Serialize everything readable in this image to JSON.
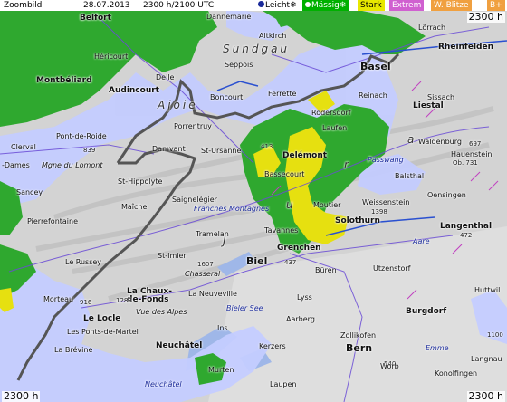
{
  "header": {
    "title": "Zoombild",
    "date": "28.07.2013",
    "info": "2300 h/2100 UTC",
    "legend": [
      {
        "key": "leicht",
        "label": "Leicht",
        "color": "#c8d0ff",
        "symbol": "❄"
      },
      {
        "key": "maessig",
        "label": "Mässig",
        "color": "#00b000",
        "symbol": "❄"
      },
      {
        "key": "stark",
        "label": "Stark",
        "color": "#e8e800",
        "symbol": ""
      },
      {
        "key": "extrem",
        "label": "Extrem",
        "color": "#d060d0",
        "symbol": ""
      },
      {
        "key": "blitze",
        "label": "W. Blitze",
        "color": "#f0a040",
        "symbol": ""
      },
      {
        "key": "bt",
        "label": "B+",
        "color": "#f0a040",
        "symbol": ""
      }
    ]
  },
  "corners": {
    "top_right": "2300 h",
    "bottom_left": "2300 h",
    "bottom_right": "2300 h"
  },
  "colors": {
    "terrain": "#d4d4d4",
    "light_rain": "#c8d0ff",
    "moderate_rain": "#2fa82f",
    "heavy_rain": "#e6e010",
    "border": "#555555",
    "roads": "#6a4bd6"
  },
  "places": [
    {
      "id": "belfort",
      "text": "Belfort",
      "cls": "mid"
    },
    {
      "id": "hericourt",
      "text": "Héricourt",
      "cls": ""
    },
    {
      "id": "montbeliard",
      "text": "Montbéliard",
      "cls": "mid"
    },
    {
      "id": "audincourt",
      "text": "Audincourt",
      "cls": "mid"
    },
    {
      "id": "delle",
      "text": "Delle",
      "cls": ""
    },
    {
      "id": "boncourt",
      "text": "Boncourt",
      "cls": ""
    },
    {
      "id": "porrentruy",
      "text": "Porrentruy",
      "cls": ""
    },
    {
      "id": "altkirch",
      "text": "Altkirch",
      "cls": ""
    },
    {
      "id": "dannemarie",
      "text": "Dannemarie",
      "cls": ""
    },
    {
      "id": "seppois",
      "text": "Seppois",
      "cls": ""
    },
    {
      "id": "ferrette",
      "text": "Ferrette",
      "cls": ""
    },
    {
      "id": "sundgau",
      "text": "Sundgau",
      "cls": "reg"
    },
    {
      "id": "basel",
      "text": "Basel",
      "cls": "big"
    },
    {
      "id": "loerrach",
      "text": "Lörrach",
      "cls": ""
    },
    {
      "id": "rheinfelden",
      "text": "Rheinfelden",
      "cls": "mid"
    },
    {
      "id": "reinach",
      "text": "Reinach",
      "cls": ""
    },
    {
      "id": "laufen",
      "text": "Laufen",
      "cls": ""
    },
    {
      "id": "liestal",
      "text": "Liestal",
      "cls": "mid"
    },
    {
      "id": "sissach",
      "text": "Sissach",
      "cls": ""
    },
    {
      "id": "waldenburg",
      "text": "Waldenburg",
      "cls": ""
    },
    {
      "id": "passwang",
      "text": "Passwang",
      "cls": "blue"
    },
    {
      "id": "balsthal",
      "text": "Balsthal",
      "cls": ""
    },
    {
      "id": "oensingen",
      "text": "Oensingen",
      "cls": ""
    },
    {
      "id": "weissenstein",
      "text": "Weissenstein",
      "cls": ""
    },
    {
      "id": "solothurn",
      "text": "Solothurn",
      "cls": "mid"
    },
    {
      "id": "langenthal",
      "text": "Langenthal",
      "cls": "mid"
    },
    {
      "id": "delemont",
      "text": "Delémont",
      "cls": "mid"
    },
    {
      "id": "bassecourt",
      "text": "Bassecourt",
      "cls": ""
    },
    {
      "id": "moutier",
      "text": "Moutier",
      "cls": ""
    },
    {
      "id": "st_ursanne",
      "text": "St-Ursanne",
      "cls": ""
    },
    {
      "id": "damvant",
      "text": "Damvant",
      "cls": ""
    },
    {
      "id": "pont_roide",
      "text": "Pont-de-Roide",
      "cls": ""
    },
    {
      "id": "clerval",
      "text": "Clerval",
      "cls": ""
    },
    {
      "id": "dames",
      "text": "-Dames",
      "cls": ""
    },
    {
      "id": "lomont",
      "text": "Mgne du Lomont",
      "cls": "ital"
    },
    {
      "id": "sancey",
      "text": "Sancey",
      "cls": ""
    },
    {
      "id": "st_hippolyte",
      "text": "St-Hippolyte",
      "cls": ""
    },
    {
      "id": "maiche",
      "text": "Maîche",
      "cls": ""
    },
    {
      "id": "saignelegier",
      "text": "Saignelégier",
      "cls": ""
    },
    {
      "id": "tramelan",
      "text": "Tramelan",
      "cls": ""
    },
    {
      "id": "tavannes",
      "text": "Tavannes",
      "cls": ""
    },
    {
      "id": "franches",
      "text": "Franches Montagnes",
      "cls": "blue"
    },
    {
      "id": "pierrefontaine",
      "text": "Pierrefontaine",
      "cls": ""
    },
    {
      "id": "le_russey",
      "text": "Le Russey",
      "cls": ""
    },
    {
      "id": "st_imier",
      "text": "St-Imier",
      "cls": ""
    },
    {
      "id": "chasseral",
      "text": "Chasseral",
      "cls": "ital"
    },
    {
      "id": "la_chaux",
      "text": "La Chaux-\nde-Fonds",
      "cls": "mid"
    },
    {
      "id": "le_locle",
      "text": "Le Locle",
      "cls": "mid"
    },
    {
      "id": "la_neuveville",
      "text": "La Neuveville",
      "cls": ""
    },
    {
      "id": "vue_alpes",
      "text": "Vue des Alpes",
      "cls": "ital"
    },
    {
      "id": "morteau",
      "text": "Morteau",
      "cls": ""
    },
    {
      "id": "ponts_martel",
      "text": "Les Ponts-de-Martel",
      "cls": ""
    },
    {
      "id": "la_brevine",
      "text": "La Brévine",
      "cls": ""
    },
    {
      "id": "neuchatel",
      "text": "Neuchâtel",
      "cls": "mid"
    },
    {
      "id": "bielersee",
      "text": "Bieler See",
      "cls": "blue"
    },
    {
      "id": "neuchatelsee",
      "text": "Neuchâtel",
      "cls": "blue"
    },
    {
      "id": "biel",
      "text": "Biel",
      "cls": "big"
    },
    {
      "id": "grenchen",
      "text": "Grenchen",
      "cls": "mid"
    },
    {
      "id": "bueren",
      "text": "Büren",
      "cls": ""
    },
    {
      "id": "utzenstorf",
      "text": "Utzenstorf",
      "cls": ""
    },
    {
      "id": "burgdorf",
      "text": "Burgdorf",
      "cls": "mid"
    },
    {
      "id": "huttwil",
      "text": "Huttwil",
      "cls": ""
    },
    {
      "id": "lyss",
      "text": "Lyss",
      "cls": ""
    },
    {
      "id": "aarberg",
      "text": "Aarberg",
      "cls": ""
    },
    {
      "id": "zollikofen",
      "text": "Zollikofen",
      "cls": ""
    },
    {
      "id": "bern",
      "text": "Bern",
      "cls": "big"
    },
    {
      "id": "kerzers",
      "text": "Kerzers",
      "cls": ""
    },
    {
      "id": "murten",
      "text": "Murten",
      "cls": ""
    },
    {
      "id": "ins",
      "text": "Ins",
      "cls": ""
    },
    {
      "id": "langnau",
      "text": "Langnau",
      "cls": ""
    },
    {
      "id": "worb",
      "text": "Worb",
      "cls": ""
    },
    {
      "id": "konolfingen",
      "text": "Konolfingen",
      "cls": ""
    },
    {
      "id": "laupen",
      "text": "Laupen",
      "cls": ""
    },
    {
      "id": "aare",
      "text": "Aare",
      "cls": "blue"
    },
    {
      "id": "emme",
      "text": "Emme",
      "cls": "blue"
    },
    {
      "id": "jura_a",
      "text": "a",
      "cls": "reg"
    },
    {
      "id": "jura_r",
      "text": "r",
      "cls": "reg"
    },
    {
      "id": "jura_u",
      "text": "u",
      "cls": "reg"
    },
    {
      "id": "jura_j",
      "text": "J",
      "cls": "reg"
    },
    {
      "id": "ajoie",
      "text": "Ajoie",
      "cls": "reg"
    },
    {
      "id": "num_839",
      "text": "839",
      "cls": "num"
    },
    {
      "id": "num_916",
      "text": "916",
      "cls": "num"
    },
    {
      "id": "num_1607",
      "text": "1607",
      "cls": "num"
    },
    {
      "id": "num_1398",
      "text": "1398",
      "cls": "num"
    },
    {
      "id": "num_437",
      "text": "437",
      "cls": "num"
    },
    {
      "id": "num_413",
      "text": "413",
      "cls": "num"
    },
    {
      "id": "num_697",
      "text": "697",
      "cls": "num"
    },
    {
      "id": "num_472",
      "text": "472",
      "cls": "num"
    },
    {
      "id": "num_540",
      "text": "540",
      "cls": "num"
    },
    {
      "id": "num_1283",
      "text": "1283",
      "cls": "num"
    },
    {
      "id": "num_1100",
      "text": "1100",
      "cls": "num"
    },
    {
      "id": "num_ob",
      "text": "Ob. 731",
      "cls": "num"
    },
    {
      "id": "hauenstein",
      "text": "Hauenstein",
      "cls": ""
    },
    {
      "id": "hodersdorf",
      "text": "Rodersdorf",
      "cls": ""
    }
  ]
}
